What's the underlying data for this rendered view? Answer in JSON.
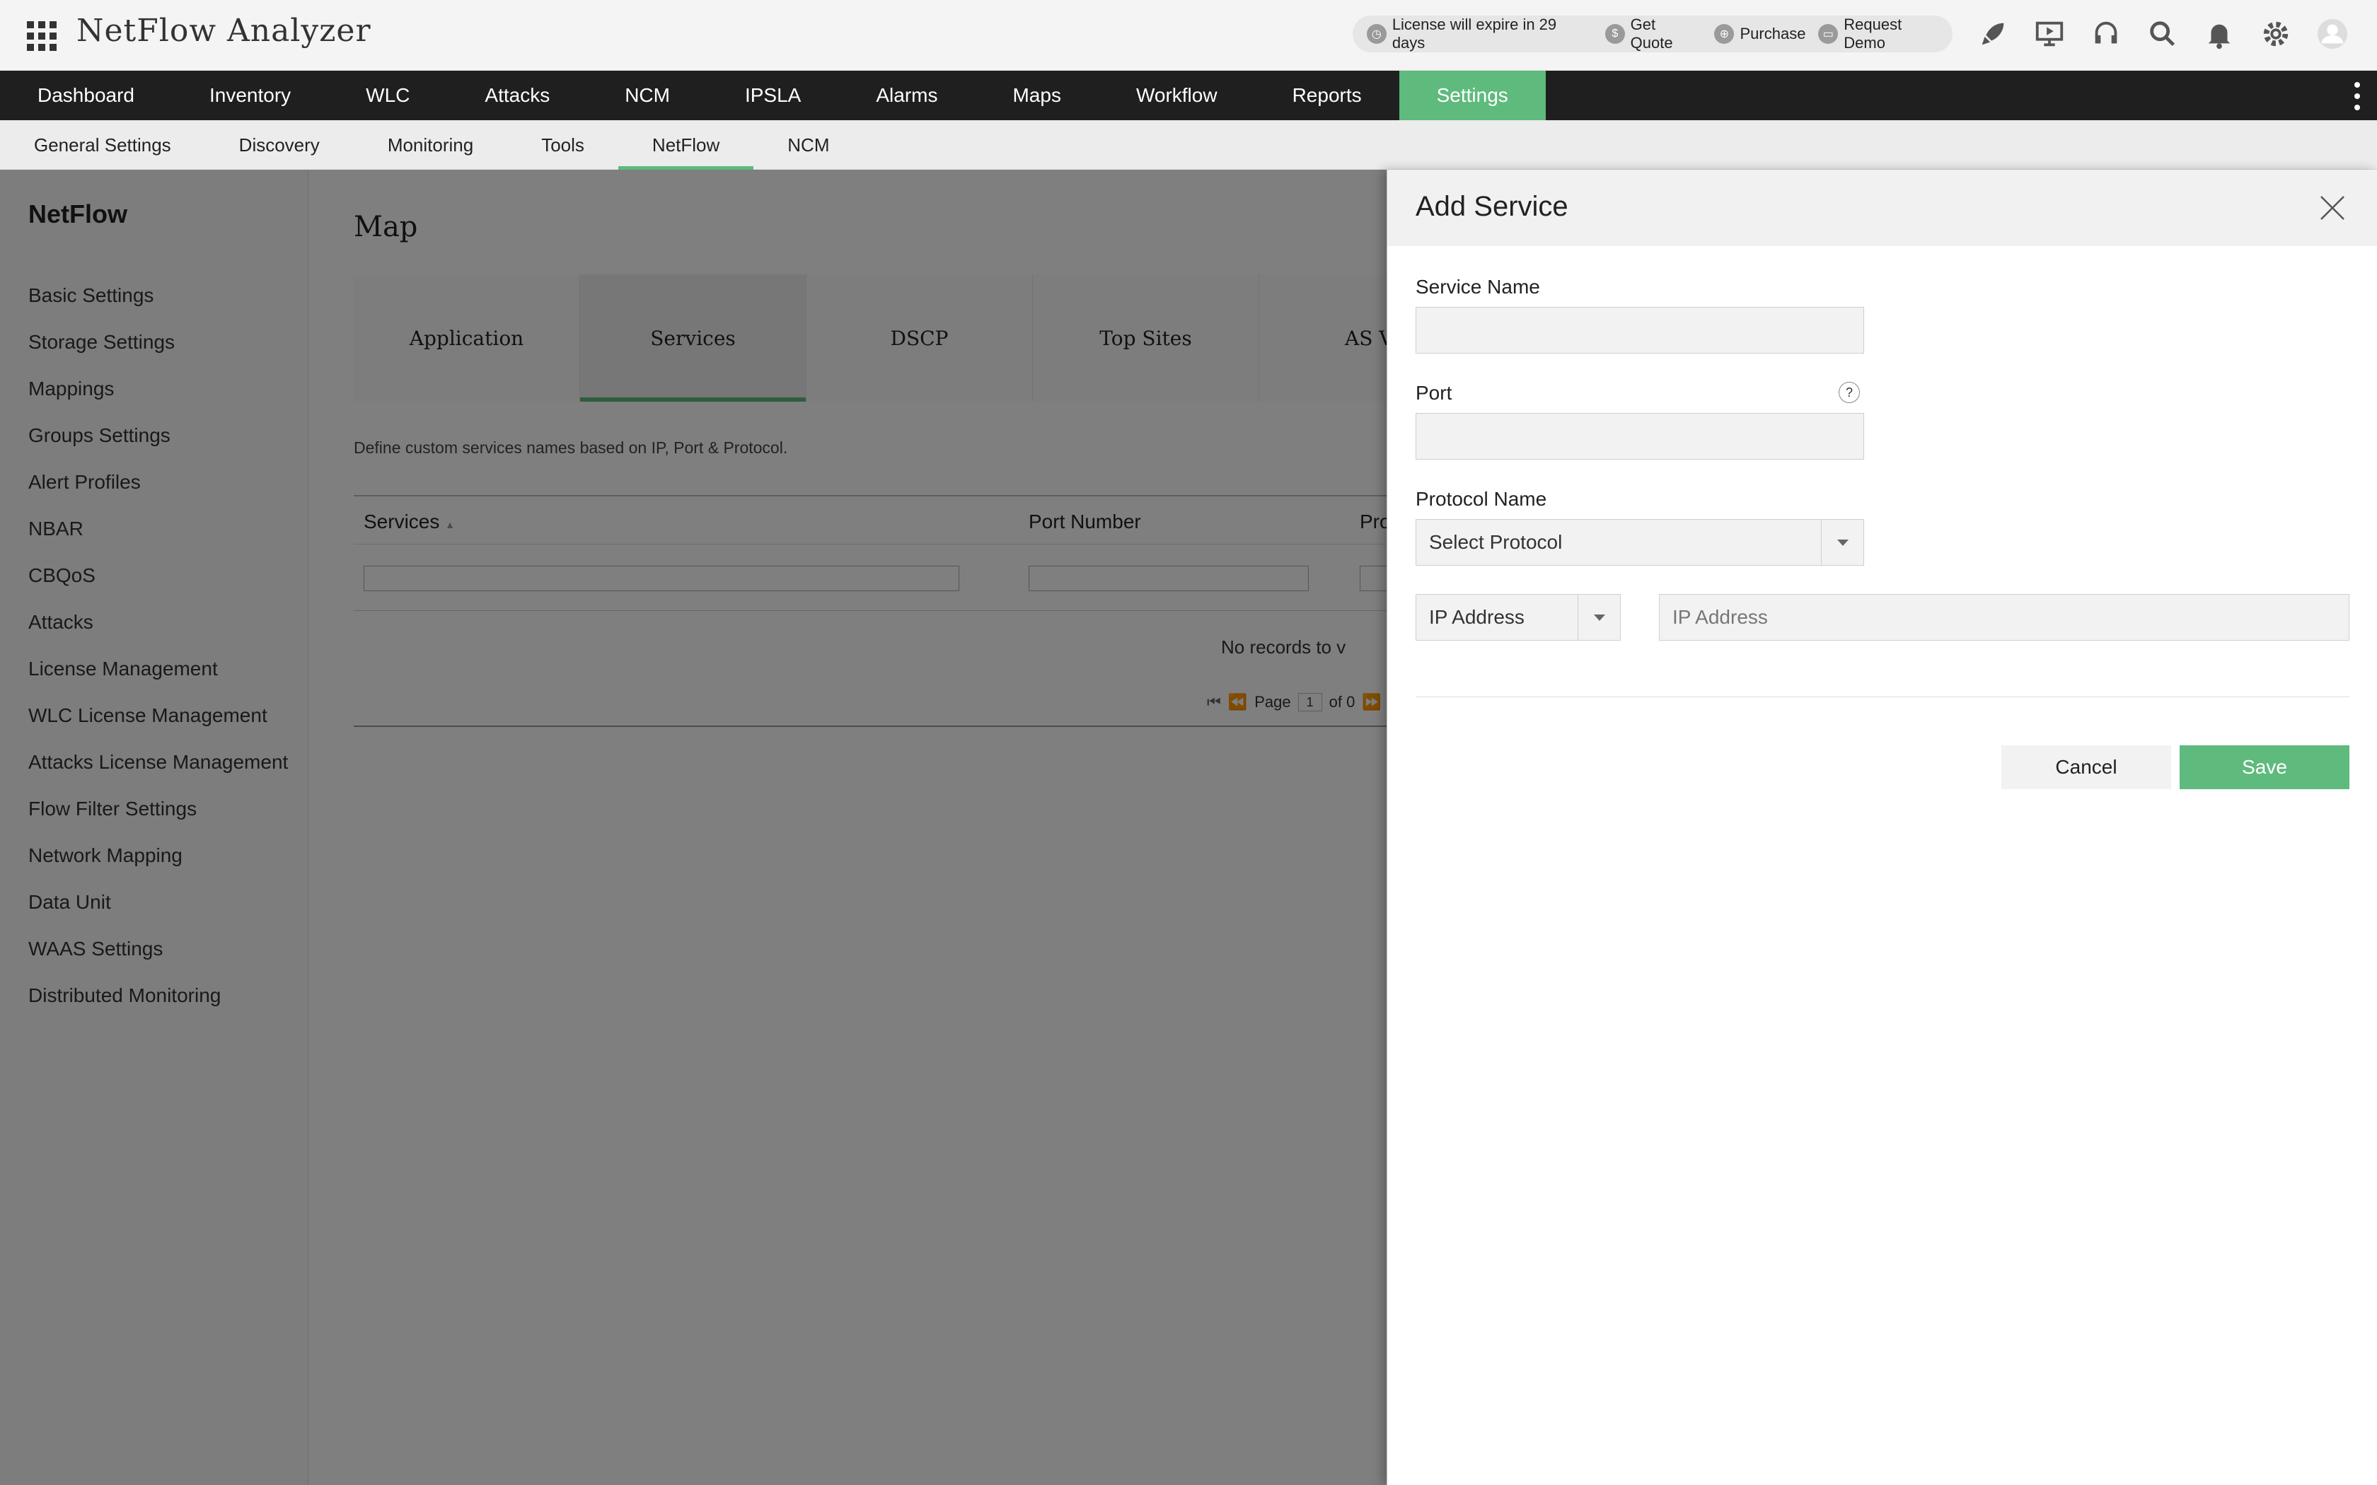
{
  "header": {
    "app_title": "NetFlow Analyzer",
    "promo": [
      {
        "label": "License will expire in 29 days",
        "icon": "clock-icon"
      },
      {
        "label": "Get Quote",
        "icon": "dollar-icon"
      },
      {
        "label": "Purchase",
        "icon": "cart-icon"
      },
      {
        "label": "Request Demo",
        "icon": "demo-icon"
      }
    ],
    "tools": [
      "rocket-icon",
      "presentation-icon",
      "headset-icon",
      "search-icon",
      "bell-icon",
      "gear-icon",
      "user-icon"
    ]
  },
  "main_nav": {
    "items": [
      "Dashboard",
      "Inventory",
      "WLC",
      "Attacks",
      "NCM",
      "IPSLA",
      "Alarms",
      "Maps",
      "Workflow",
      "Reports",
      "Settings"
    ],
    "active": "Settings"
  },
  "sub_nav": {
    "items": [
      "General Settings",
      "Discovery",
      "Monitoring",
      "Tools",
      "NetFlow",
      "NCM"
    ],
    "active": "NetFlow"
  },
  "sidebar": {
    "title": "NetFlow",
    "items": [
      "Basic Settings",
      "Storage Settings",
      "Mappings",
      "Groups Settings",
      "Alert Profiles",
      "NBAR",
      "CBQoS",
      "Attacks",
      "License Management",
      "WLC License Management",
      "Attacks License Management",
      "Flow Filter Settings",
      "Network Mapping",
      "Data Unit",
      "WAAS Settings",
      "Distributed Monitoring"
    ]
  },
  "content": {
    "title": "Map",
    "tabs": [
      "Application",
      "Services",
      "DSCP",
      "Top Sites",
      "AS Vi"
    ],
    "active_tab": "Services",
    "description": "Define custom services names based on IP, Port & Protocol.",
    "table": {
      "columns": [
        "Services",
        "Port Number",
        "Pro"
      ],
      "empty_text": "No records to v",
      "pager": {
        "page_label": "Page",
        "page_value": "1",
        "of_label": "of 0"
      }
    }
  },
  "drawer": {
    "title": "Add Service",
    "service_name_label": "Service Name",
    "service_name_value": "",
    "port_label": "Port",
    "port_help": "?",
    "port_value": "",
    "protocol_label": "Protocol Name",
    "protocol_value": "Select Protocol",
    "ip_type_value": "IP Address",
    "ip_placeholder": "IP Address",
    "cancel_label": "Cancel",
    "save_label": "Save"
  },
  "colors": {
    "accent": "#5fba7d",
    "nav_bg": "#1f1f1f",
    "overlay": "rgba(0,0,0,0.5)"
  }
}
